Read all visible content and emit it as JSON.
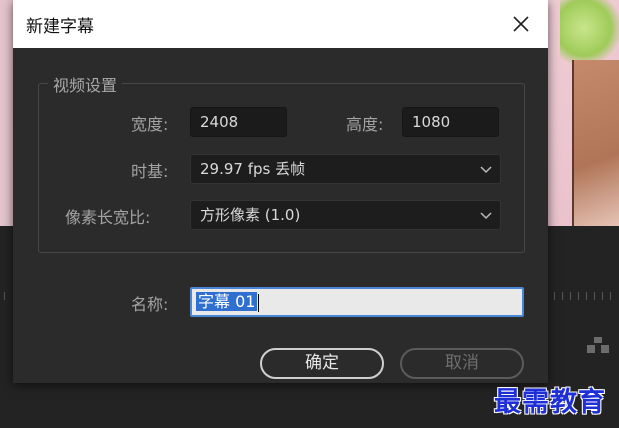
{
  "dialog": {
    "title": "新建字幕",
    "close_icon": "close-icon",
    "video_settings": {
      "group_title": "视频设置",
      "width_label": "宽度:",
      "width_value": "2408",
      "height_label": "高度:",
      "height_value": "1080",
      "timebase_label": "时基:",
      "timebase_value": "29.97 fps 丢帧",
      "pixel_aspect_label": "像素长宽比:",
      "pixel_aspect_value": "方形像素 (1.0)"
    },
    "name_label": "名称:",
    "name_value": "字幕 01",
    "ok_label": "确定",
    "cancel_label": "取消"
  },
  "watermark": "最需教育",
  "colors": {
    "dialog_bg": "#2b2b2b",
    "title_bar_bg": "#ffffff",
    "selection": "#2f6fd0",
    "watermark": "#1e2fd6"
  }
}
